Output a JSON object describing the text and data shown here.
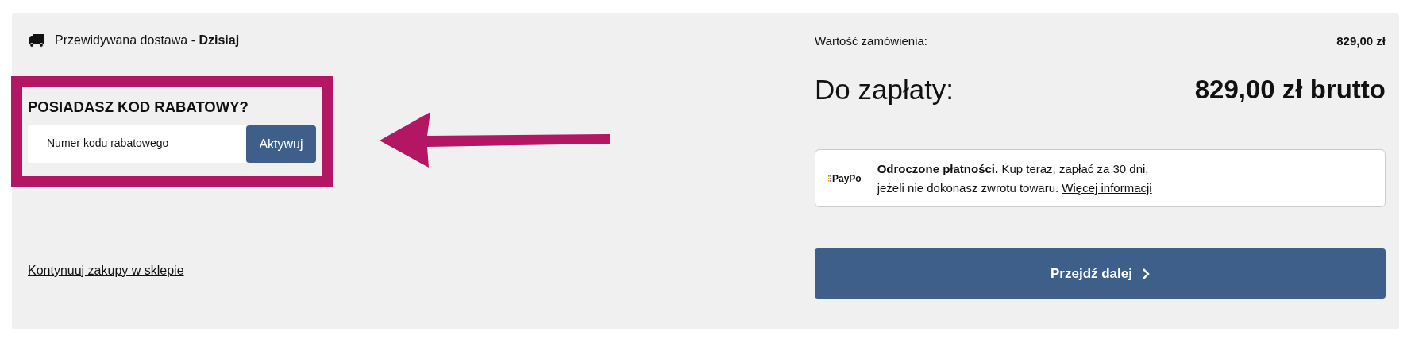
{
  "delivery": {
    "text": "Przewidywana dostawa - **Dzisiaj**"
  },
  "discount": {
    "heading": "POSIADASZ KOD RABATOWY?",
    "placeholder": "Numer kodu rabatowego",
    "button": "Aktywuj"
  },
  "continue_link": "Kontynuuj zakupy w sklepie",
  "summary": {
    "order_value_label": "Wartość zamówienia:",
    "order_value": "829,00 zł",
    "total_label": "Do zapłaty:",
    "total": "829,00 zł brutto"
  },
  "paypo": {
    "logo": "PayPo",
    "text": "**Odroczone płatności.** Kup teraz, zapłać za 30 dni, jeżeli nie dokonasz zwrotu towaru.",
    "link": "Więcej informacji"
  },
  "next_button": "Przejdź dalej"
}
